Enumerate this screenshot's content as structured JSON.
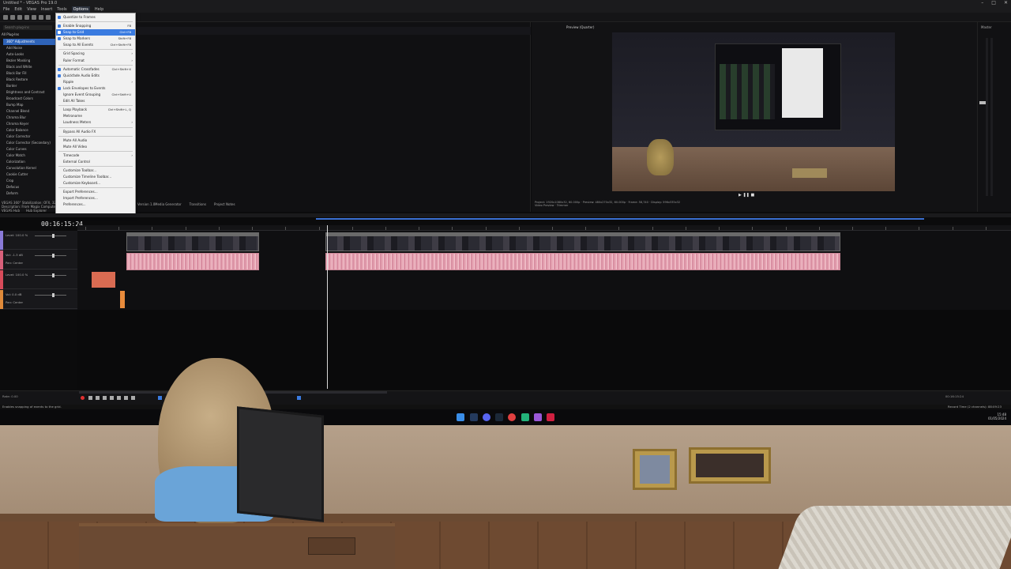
{
  "app": {
    "title": "Untitled * - VEGAS Pro 19.0",
    "window_controls": [
      "–",
      "□",
      "✕"
    ]
  },
  "menu": {
    "items": [
      "File",
      "Edit",
      "View",
      "Insert",
      "Tools",
      "Options",
      "Help"
    ],
    "active": "Options"
  },
  "left_panel": {
    "search_placeholder": "Search plug-ins",
    "tree_label": "All Plug-Ins",
    "items": [
      "360° Adjustments",
      "Add Noise",
      "Auto-Looks",
      "Bezier Masking",
      "Black and White",
      "Block Bar Fill",
      "Black Restore",
      "Border",
      "Brightness and Contrast",
      "Broadcast Colors",
      "Bump Map",
      "Channel Blend",
      "Chroma Blur",
      "Chroma Keyer",
      "Color Balance",
      "Color Corrector",
      "Color Corrector (Secondary)",
      "Color Curves",
      "Color Match",
      "Colorization",
      "Convolution Kernel",
      "Cookie Cutter",
      "Crop",
      "Defocus",
      "Deform"
    ],
    "selected_index": 0,
    "footer": [
      "VEGAS 360° Stabilization: OFX, 32-bit",
      "Description: From Magix Computer Products"
    ],
    "tabs": [
      "VEGAS Hub",
      "Hub Explorer"
    ]
  },
  "options_menu": {
    "items": [
      {
        "label": "Quantize to Frames",
        "shortcut": "",
        "checked": true,
        "submenu": false,
        "highlight": false
      },
      {
        "sep": true
      },
      {
        "label": "Enable Snapping",
        "shortcut": "F8",
        "checked": true,
        "submenu": false,
        "highlight": false
      },
      {
        "label": "Snap to Grid",
        "shortcut": "Ctrl+F8",
        "checked": true,
        "submenu": false,
        "highlight": true
      },
      {
        "label": "Snap to Markers",
        "shortcut": "Shift+F8",
        "checked": true,
        "submenu": false,
        "highlight": false
      },
      {
        "label": "Snap to All Events",
        "shortcut": "Ctrl+Shift+F8",
        "checked": false,
        "submenu": false,
        "highlight": false
      },
      {
        "sep": true
      },
      {
        "label": "Grid Spacing",
        "shortcut": "",
        "checked": false,
        "submenu": true,
        "highlight": false
      },
      {
        "label": "Ruler Format",
        "shortcut": "",
        "checked": false,
        "submenu": true,
        "highlight": false
      },
      {
        "sep": true
      },
      {
        "label": "Automatic Crossfades",
        "shortcut": "Ctrl+Shift+X",
        "checked": true,
        "submenu": false,
        "highlight": false
      },
      {
        "label": "Quickfade Audio Edits",
        "shortcut": "",
        "checked": true,
        "submenu": false,
        "highlight": false
      },
      {
        "label": "Ripple",
        "shortcut": "",
        "checked": false,
        "submenu": true,
        "highlight": false
      },
      {
        "label": "Lock Envelopes to Events",
        "shortcut": "",
        "checked": true,
        "submenu": false,
        "highlight": false
      },
      {
        "label": "Ignore Event Grouping",
        "shortcut": "Ctrl+Shift+U",
        "checked": false,
        "submenu": false,
        "highlight": false
      },
      {
        "label": "Edit All Takes",
        "shortcut": "",
        "checked": false,
        "submenu": false,
        "highlight": false
      },
      {
        "sep": true
      },
      {
        "label": "Loop Playback",
        "shortcut": "Ctrl+Shift+L, Q",
        "checked": false,
        "submenu": false,
        "highlight": false
      },
      {
        "label": "Metronome",
        "shortcut": "",
        "checked": false,
        "submenu": false,
        "highlight": false
      },
      {
        "label": "Loudness Meters",
        "shortcut": "",
        "checked": false,
        "submenu": true,
        "highlight": false
      },
      {
        "sep": true
      },
      {
        "label": "Bypass All Audio FX",
        "shortcut": "",
        "checked": false,
        "submenu": false,
        "highlight": false
      },
      {
        "sep": true
      },
      {
        "label": "Mute All Audio",
        "shortcut": "",
        "checked": false,
        "submenu": false,
        "highlight": false
      },
      {
        "label": "Mute All Video",
        "shortcut": "",
        "checked": false,
        "submenu": false,
        "highlight": false
      },
      {
        "sep": true
      },
      {
        "label": "Timecode",
        "shortcut": "",
        "checked": false,
        "submenu": true,
        "highlight": false
      },
      {
        "label": "External Control",
        "shortcut": "",
        "checked": false,
        "submenu": false,
        "highlight": false
      },
      {
        "sep": true
      },
      {
        "label": "Customize Toolbar...",
        "shortcut": "",
        "checked": false,
        "submenu": false,
        "highlight": false
      },
      {
        "label": "Customize Timeline Toolbar...",
        "shortcut": "",
        "checked": false,
        "submenu": false,
        "highlight": false
      },
      {
        "label": "Customize Keyboard...",
        "shortcut": "",
        "checked": false,
        "submenu": false,
        "highlight": false
      },
      {
        "sep": true
      },
      {
        "label": "Export Preferences...",
        "shortcut": "",
        "checked": false,
        "submenu": false,
        "highlight": false
      },
      {
        "label": "Import Preferences...",
        "shortcut": "",
        "checked": false,
        "submenu": false,
        "highlight": false
      },
      {
        "label": "Preferences...",
        "shortcut": "",
        "checked": false,
        "submenu": false,
        "highlight": false
      }
    ]
  },
  "mid_panel": {
    "version": "Version 1.0",
    "tabs": [
      "Media Generator",
      "Transitions",
      "Project Notes"
    ]
  },
  "preview": {
    "toolbar_label": "Preview (Quarter)",
    "info": [
      "Project: 1920x1080x32, 60.000p",
      "Preview: 480x270x32, 60.000p",
      "Video Preview",
      "Trimmer"
    ],
    "frame": "Frame: 58,740",
    "display": "Display: 596x335x32"
  },
  "master": {
    "label": "Master"
  },
  "timeline": {
    "timecode": "00:16:15:24",
    "tracks": [
      {
        "type": "video",
        "label": "Level: 100.0 %",
        "color": "#8a7ad8"
      },
      {
        "type": "audio",
        "label": "Vol: -1.3 dB",
        "pan": "Pan: Center",
        "color": "#d8607a"
      },
      {
        "type": "video",
        "label": "Level: 100.0 %",
        "color": "#d84b5a"
      },
      {
        "type": "audio",
        "label": "Vol: 0.0 dB",
        "pan": "Pan: Center",
        "color": "#e08a3a"
      }
    ],
    "ruler_ticks": 28
  },
  "transport": {
    "rate": "Rate: 0.00",
    "record_time": "Record Time (2 channels): 88:09:23",
    "cursor_time": "00:16:15:24"
  },
  "status": {
    "message": "Enables snapping of events to the grid."
  },
  "taskbar": {
    "time": "15:48",
    "date": "01/05/2024"
  },
  "colors": {
    "accent": "#3a7be0",
    "audio_clip": "#e6a6b4",
    "timeline_bg": "#0f0f11"
  }
}
